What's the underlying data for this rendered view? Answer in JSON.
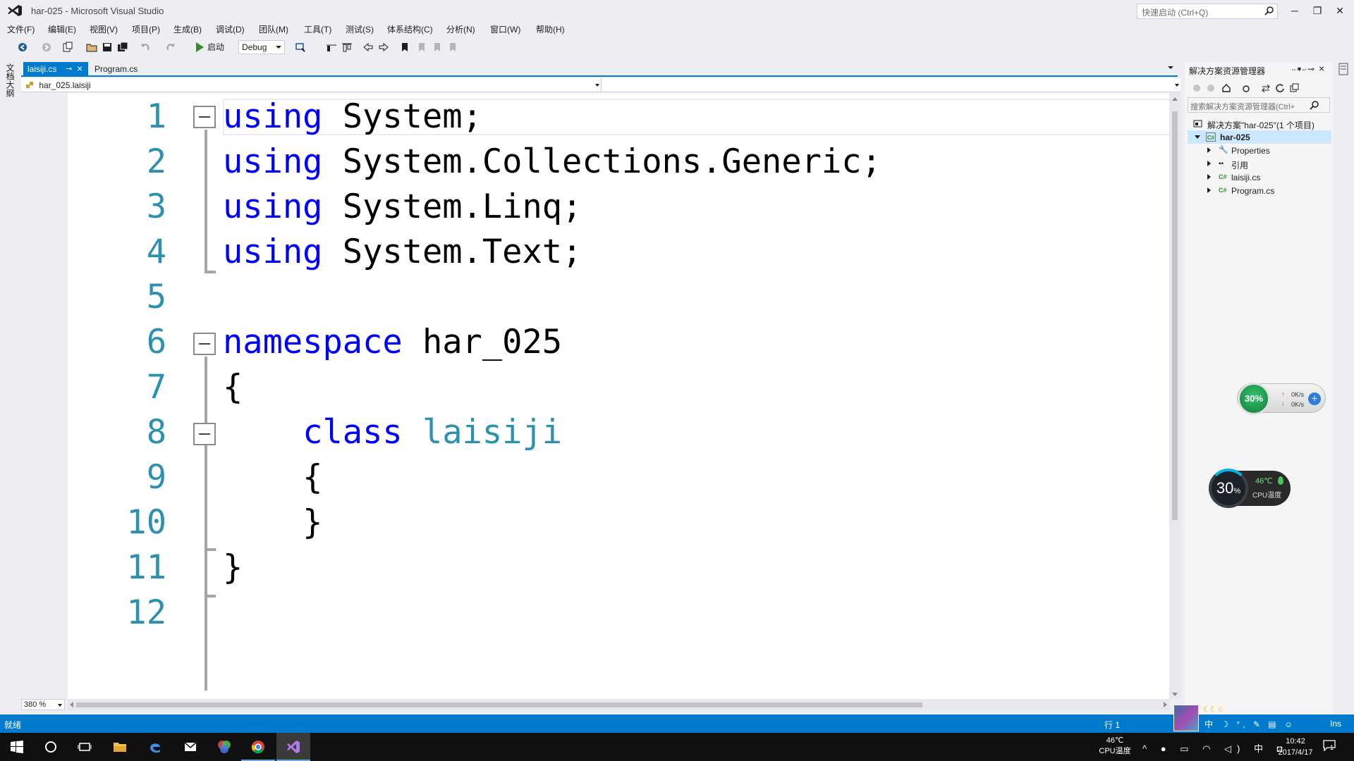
{
  "window": {
    "title": "har-025 - Microsoft Visual Studio",
    "quick_launch_placeholder": "快速启动 (Ctrl+Q)",
    "minimize": "─",
    "restore": "❐",
    "close": "✕"
  },
  "menu": [
    "文件(F)",
    "编辑(E)",
    "视图(V)",
    "项目(P)",
    "生成(B)",
    "调试(D)",
    "团队(M)",
    "工具(T)",
    "测试(S)",
    "体系结构(C)",
    "分析(N)",
    "窗口(W)",
    "帮助(H)"
  ],
  "toolbar": {
    "start_label": "启动",
    "configuration": "Debug"
  },
  "left_strip": {
    "label": "文档大纲"
  },
  "tabs": [
    {
      "label": "laisiji.cs",
      "active": true
    },
    {
      "label": "Program.cs",
      "active": false
    }
  ],
  "navbar": {
    "left_value": "har_025.laisiji",
    "right_value": ""
  },
  "editor": {
    "zoom": "380 %",
    "lines": [
      {
        "num": "1",
        "tokens": [
          [
            "kw",
            "using"
          ],
          [
            "",
            " System;"
          ]
        ]
      },
      {
        "num": "2",
        "tokens": [
          [
            "kw",
            "using"
          ],
          [
            "",
            " System.Collections.Generic;"
          ]
        ]
      },
      {
        "num": "3",
        "tokens": [
          [
            "kw",
            "using"
          ],
          [
            "",
            " System.Linq;"
          ]
        ]
      },
      {
        "num": "4",
        "tokens": [
          [
            "kw",
            "using"
          ],
          [
            "",
            " System.Text;"
          ]
        ]
      },
      {
        "num": "5",
        "tokens": []
      },
      {
        "num": "6",
        "tokens": [
          [
            "kw",
            "namespace"
          ],
          [
            "",
            " har_025"
          ]
        ]
      },
      {
        "num": "7",
        "tokens": [
          [
            "",
            "{"
          ]
        ]
      },
      {
        "num": "8",
        "tokens": [
          [
            "",
            "    "
          ],
          [
            "kw",
            "class"
          ],
          [
            "",
            " "
          ],
          [
            "type",
            "laisiji"
          ]
        ]
      },
      {
        "num": "9",
        "tokens": [
          [
            "",
            "    {"
          ]
        ]
      },
      {
        "num": "10",
        "tokens": [
          [
            "",
            "    }"
          ]
        ]
      },
      {
        "num": "11",
        "tokens": [
          [
            "",
            "}"
          ]
        ]
      },
      {
        "num": "12",
        "tokens": []
      }
    ],
    "colors": {
      "keyword": "#0000ff",
      "type": "#2b91af",
      "line_number": "#2b91af"
    }
  },
  "solution_explorer": {
    "title": "解决方案资源管理器",
    "search_placeholder": "搜索解决方案资源管理器(Ctrl+",
    "tree": [
      {
        "label": "解决方案\"har-025\"(1 个项目)",
        "icon": "solution-icon",
        "expander": "none"
      },
      {
        "label": "har-025",
        "icon": "csharp-project-icon",
        "expander": "expanded",
        "selected": true
      },
      {
        "label": "Properties",
        "icon": "wrench-icon",
        "expander": "collapsed"
      },
      {
        "label": "引用",
        "icon": "references-icon",
        "expander": "collapsed"
      },
      {
        "label": "laisiji.cs",
        "icon": "csharp-file-icon",
        "expander": "collapsed"
      },
      {
        "label": "Program.cs",
        "icon": "csharp-file-icon",
        "expander": "collapsed"
      }
    ]
  },
  "widgets": {
    "net_percent": "30%",
    "net_up": "0K/s",
    "net_down": "0K/s",
    "cpu_value": "30",
    "cpu_unit": "%",
    "cpu_temp": "46℃",
    "cpu_label": "CPU温度"
  },
  "statusbar": {
    "text": "就绪",
    "line": "行 1",
    "mode": "Ins",
    "ime": "中 ☽ °, ✎ ▤ ☺"
  },
  "taskbar": {
    "temp": "46℃",
    "temp_label": "CPU温度",
    "tray": "^ ● ▭ ◠ ◁) 中 ◘",
    "time": "10:42",
    "date": "2017/4/17",
    "notify_count": "1"
  }
}
